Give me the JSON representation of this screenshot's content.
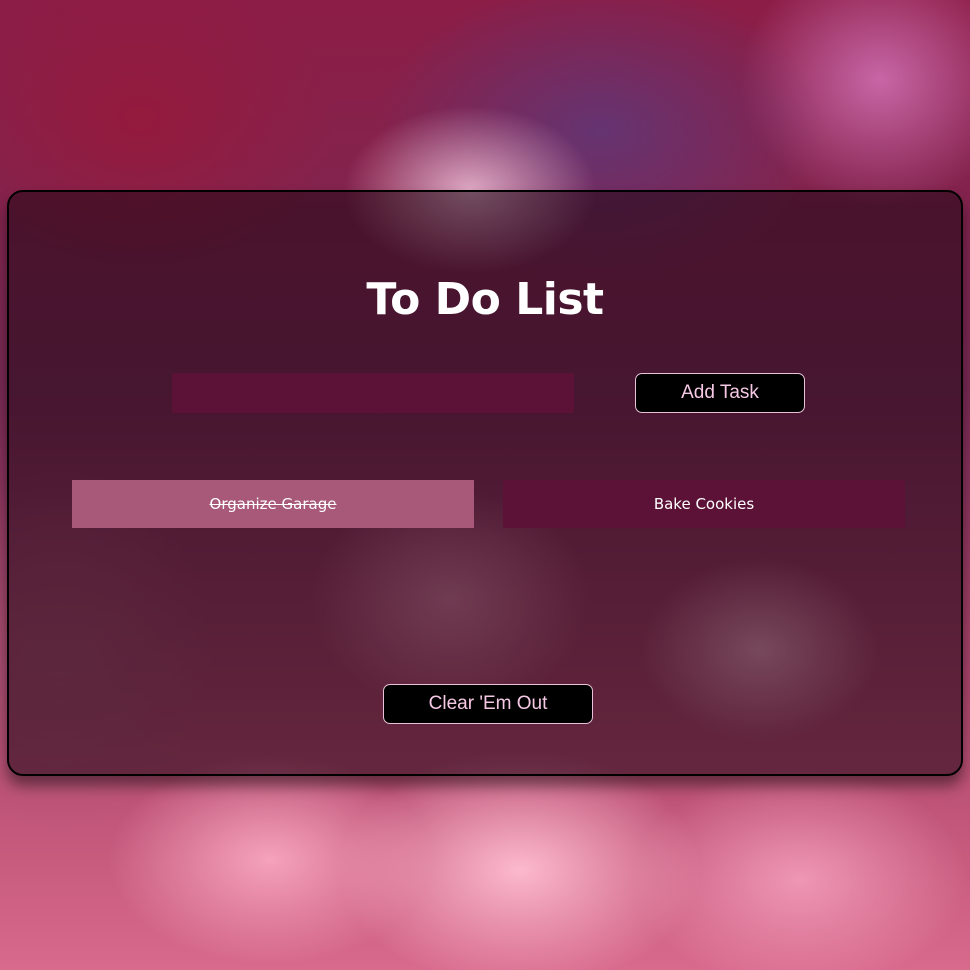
{
  "app": {
    "title": "To Do List"
  },
  "form": {
    "input_value": "",
    "input_placeholder": "",
    "add_label": "Add Task"
  },
  "tasks": [
    {
      "label": "Organize Garage",
      "completed": true
    },
    {
      "label": "Bake Cookies",
      "completed": false
    }
  ],
  "actions": {
    "clear_label": "Clear 'Em Out"
  },
  "colors": {
    "card_overlay": "#1e0612",
    "input_bg": "#5c1236",
    "task_open_bg": "#5c1236",
    "task_done_bg": "#a85878",
    "button_bg": "#000000",
    "button_text": "#f5c8e4",
    "title_text": "#ffffff"
  }
}
